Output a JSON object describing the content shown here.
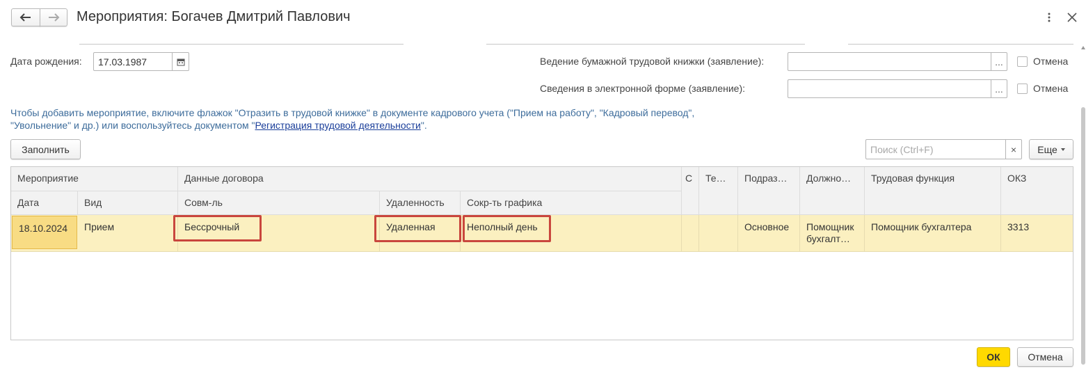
{
  "window": {
    "title": "Мероприятия: Богачев Дмитрий Павлович",
    "back_icon": "arrow-left-icon",
    "forward_icon": "arrow-right-icon",
    "more_icon": "more-vertical-icon",
    "close_icon": "close-icon"
  },
  "form": {
    "birth_date_label": "Дата рождения:",
    "birth_date_value": "17.03.1987",
    "paper_book_label": "Ведение бумажной трудовой книжки (заявление):",
    "paper_book_value": "",
    "electronic_label": "Сведения в электронной форме (заявление):",
    "electronic_value": "",
    "cancel_checkbox_label_1": "Отмена",
    "cancel_checkbox_label_2": "Отмена",
    "select_button": "...",
    "info_text_part1": "Чтобы добавить мероприятие, включите флажок \"Отразить в трудовой книжке\" в документе кадрового учета (\"Прием на работу\", \"Кадровый перевод\",",
    "info_text_part2_prefix": "\"Увольнение\" и др.) или воспользуйтесь документом \"",
    "info_text_link": "Регистрация трудовой деятельности",
    "info_text_part2_suffix": "\"."
  },
  "toolbar": {
    "fill_button": "Заполнить",
    "search_placeholder": "Поиск (Ctrl+F)",
    "search_clear": "×",
    "more_button": "Еще"
  },
  "table": {
    "group_headers": {
      "event": "Мероприятие",
      "contract": "Данные договора",
      "col_c": "С",
      "col_te": "Те…",
      "subdivision": "Подраз…",
      "position": "Должно…",
      "labor_function": "Трудовая функция",
      "okz": "ОКЗ"
    },
    "sub_headers": {
      "date": "Дата",
      "kind": "Вид",
      "combination": "Совм-ль",
      "remoteness": "Удаленность",
      "reduced_schedule": "Сокр-ть графика"
    },
    "rows": [
      {
        "date": "18.10.2024",
        "kind": "Прием",
        "combination": "Бессрочный",
        "remoteness": "Удаленная",
        "reduced_schedule": "Неполный день",
        "col_c": "",
        "col_te": "",
        "subdivision": "Основное",
        "position": "Помощник бухгалт…",
        "labor_function": "Помощник бухгалтера",
        "okz": "3313"
      }
    ]
  },
  "footer": {
    "ok_button": "ОК",
    "cancel_button": "Отмена"
  },
  "colors": {
    "selected_row": "#fbf0c0",
    "highlight_border": "#c9463d",
    "ok_button": "#ffd900",
    "link": "#3d6c9b"
  }
}
